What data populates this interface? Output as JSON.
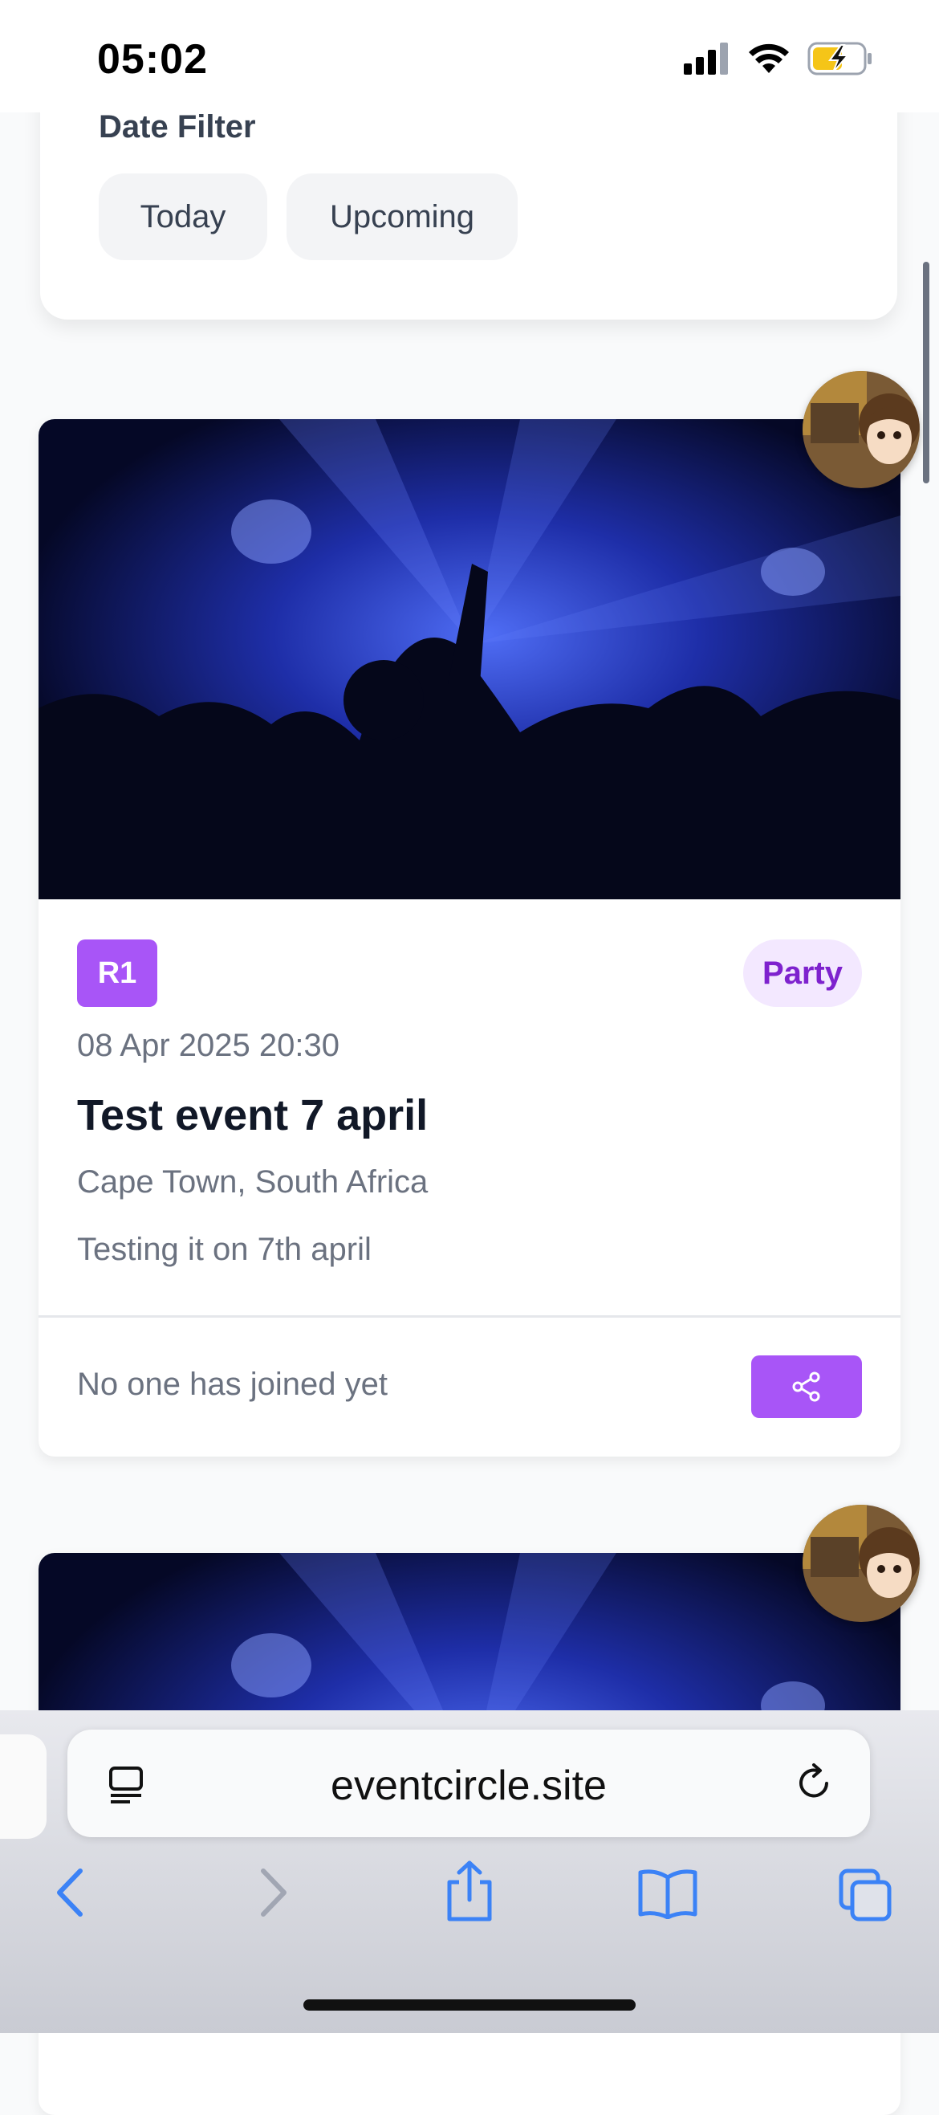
{
  "status_bar": {
    "time": "05:02",
    "icons": [
      "cellular-signal-icon",
      "wifi-icon",
      "battery-charging-icon"
    ]
  },
  "filter": {
    "title": "Date Filter",
    "chips": [
      "Today",
      "Upcoming"
    ]
  },
  "events": [
    {
      "badge": "R1",
      "category": "Party",
      "date": "08 Apr 2025 20:30",
      "title": "Test event 7 april",
      "location": "Cape Town, South Africa",
      "description": "Testing it on 7th april",
      "joined_text": "No one has joined yet"
    }
  ],
  "browser": {
    "url": "eventcircle.site"
  },
  "colors": {
    "accent": "#a855f7",
    "pill_bg": "#f3e8ff",
    "pill_text": "#7e22ce"
  }
}
